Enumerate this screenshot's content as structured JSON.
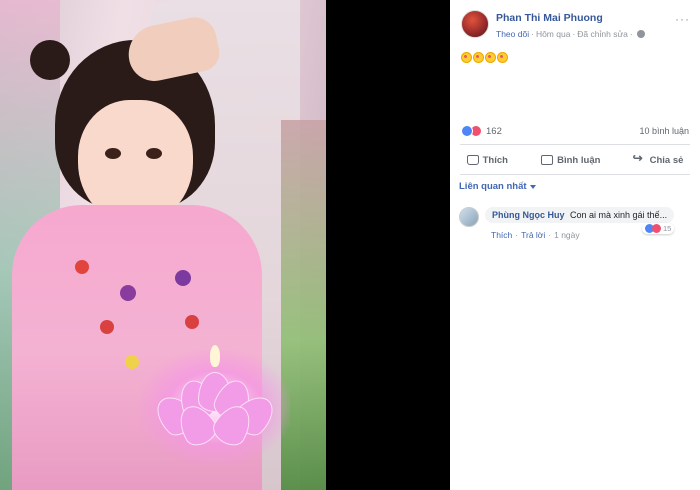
{
  "post": {
    "author": "Phan Thi Mai Phuong",
    "follow_label": "Theo dõi",
    "separator": "·",
    "time": "Hôm qua",
    "edited": "Đã chỉnh sửa",
    "privacy_icon": "globe-icon",
    "more_icon": "more-options-icon",
    "content_emojis": [
      "kiss-emoji",
      "kiss-emoji",
      "kiss-emoji",
      "kiss-emoji"
    ],
    "reaction_count": "162",
    "comment_count": "10 bình luận"
  },
  "actions": {
    "like": "Thích",
    "comment": "Bình luận",
    "share": "Chia sẻ"
  },
  "sort": {
    "label": "Liên quan nhất"
  },
  "comments": [
    {
      "author": "Phùng Ngọc Huy",
      "text": "Con ai mà xinh gái thế...",
      "reaction_count": "15",
      "like_label": "Thích",
      "reply_label": "Trả lời",
      "time": "1 ngày"
    }
  ],
  "colors": {
    "link_blue": "#365899",
    "accent_blue": "#4267b2",
    "like_blue": "#4f86f7",
    "love_red": "#f0506e"
  }
}
